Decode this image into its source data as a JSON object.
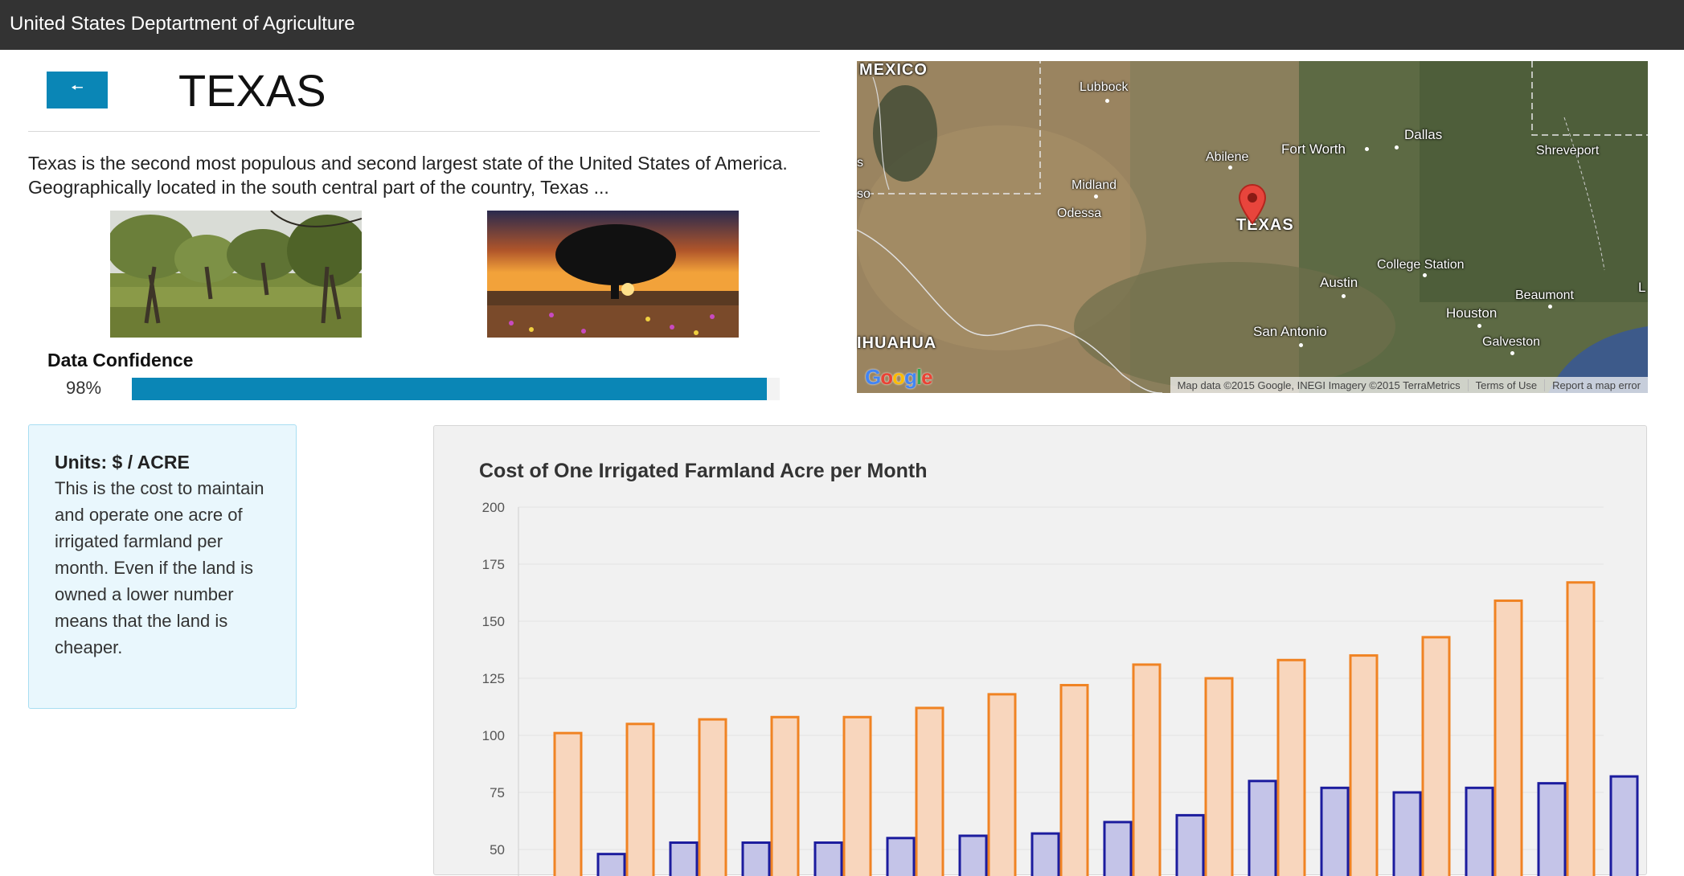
{
  "header": {
    "brand": "United States Deptartment of Agriculture"
  },
  "back_button": {
    "icon": "arrow-left-icon",
    "label": "🠔"
  },
  "page": {
    "title": "TEXAS",
    "description": "Texas is the second most populous and second largest state of the United States of America. Geographically located in the south central part of the country, Texas ..."
  },
  "confidence": {
    "label": "Data Confidence",
    "percent_text": "98%",
    "value": 0.98,
    "color": "#0a86b6"
  },
  "map": {
    "labels": {
      "mexico": "MEXICO",
      "lubbock": "Lubbock",
      "abilene": "Abilene",
      "fort_worth": "Fort Worth",
      "dallas": "Dallas",
      "shreveport": "Shreveport",
      "midland": "Midland",
      "odessa": "Odessa",
      "texas": "TEXAS",
      "college_station": "College Station",
      "austin": "Austin",
      "beaumont": "Beaumont",
      "houston": "Houston",
      "san_antonio": "San Antonio",
      "galveston": "Galveston",
      "chihuahua": "IHUAHUA",
      "edge_s": "s",
      "edge_so": "so",
      "edge_l": "L"
    },
    "logo": "Google",
    "attribution": {
      "data": "Map data ©2015 Google, INEGI Imagery ©2015 TerraMetrics",
      "terms": "Terms of Use",
      "report": "Report a map error"
    }
  },
  "units": {
    "title": "Units: $ / ACRE",
    "text": "This is the cost to maintain and operate one acre of irrigated farmland per month. Even if the land is owned a lower number means that the land is cheaper."
  },
  "chart_data": {
    "type": "bar",
    "title": "Cost of One Irrigated Farmland Acre per Month",
    "y_ticks": [
      "200",
      "175",
      "150",
      "125",
      "100",
      "75",
      "50"
    ],
    "ylim": [
      50,
      200
    ],
    "grid": true,
    "series": [
      {
        "values": [
          101,
          105,
          107,
          108,
          108,
          112,
          118,
          122,
          131,
          125,
          133,
          135,
          143,
          159,
          167
        ],
        "fill": "#f8d6bd",
        "stroke": "#f08323"
      },
      {
        "values": [
          48,
          53,
          53,
          53,
          55,
          56,
          57,
          62,
          65,
          80,
          77,
          75,
          77,
          79,
          82
        ],
        "fill": "#c4c4e8",
        "stroke": "#1c1c9e"
      }
    ]
  }
}
